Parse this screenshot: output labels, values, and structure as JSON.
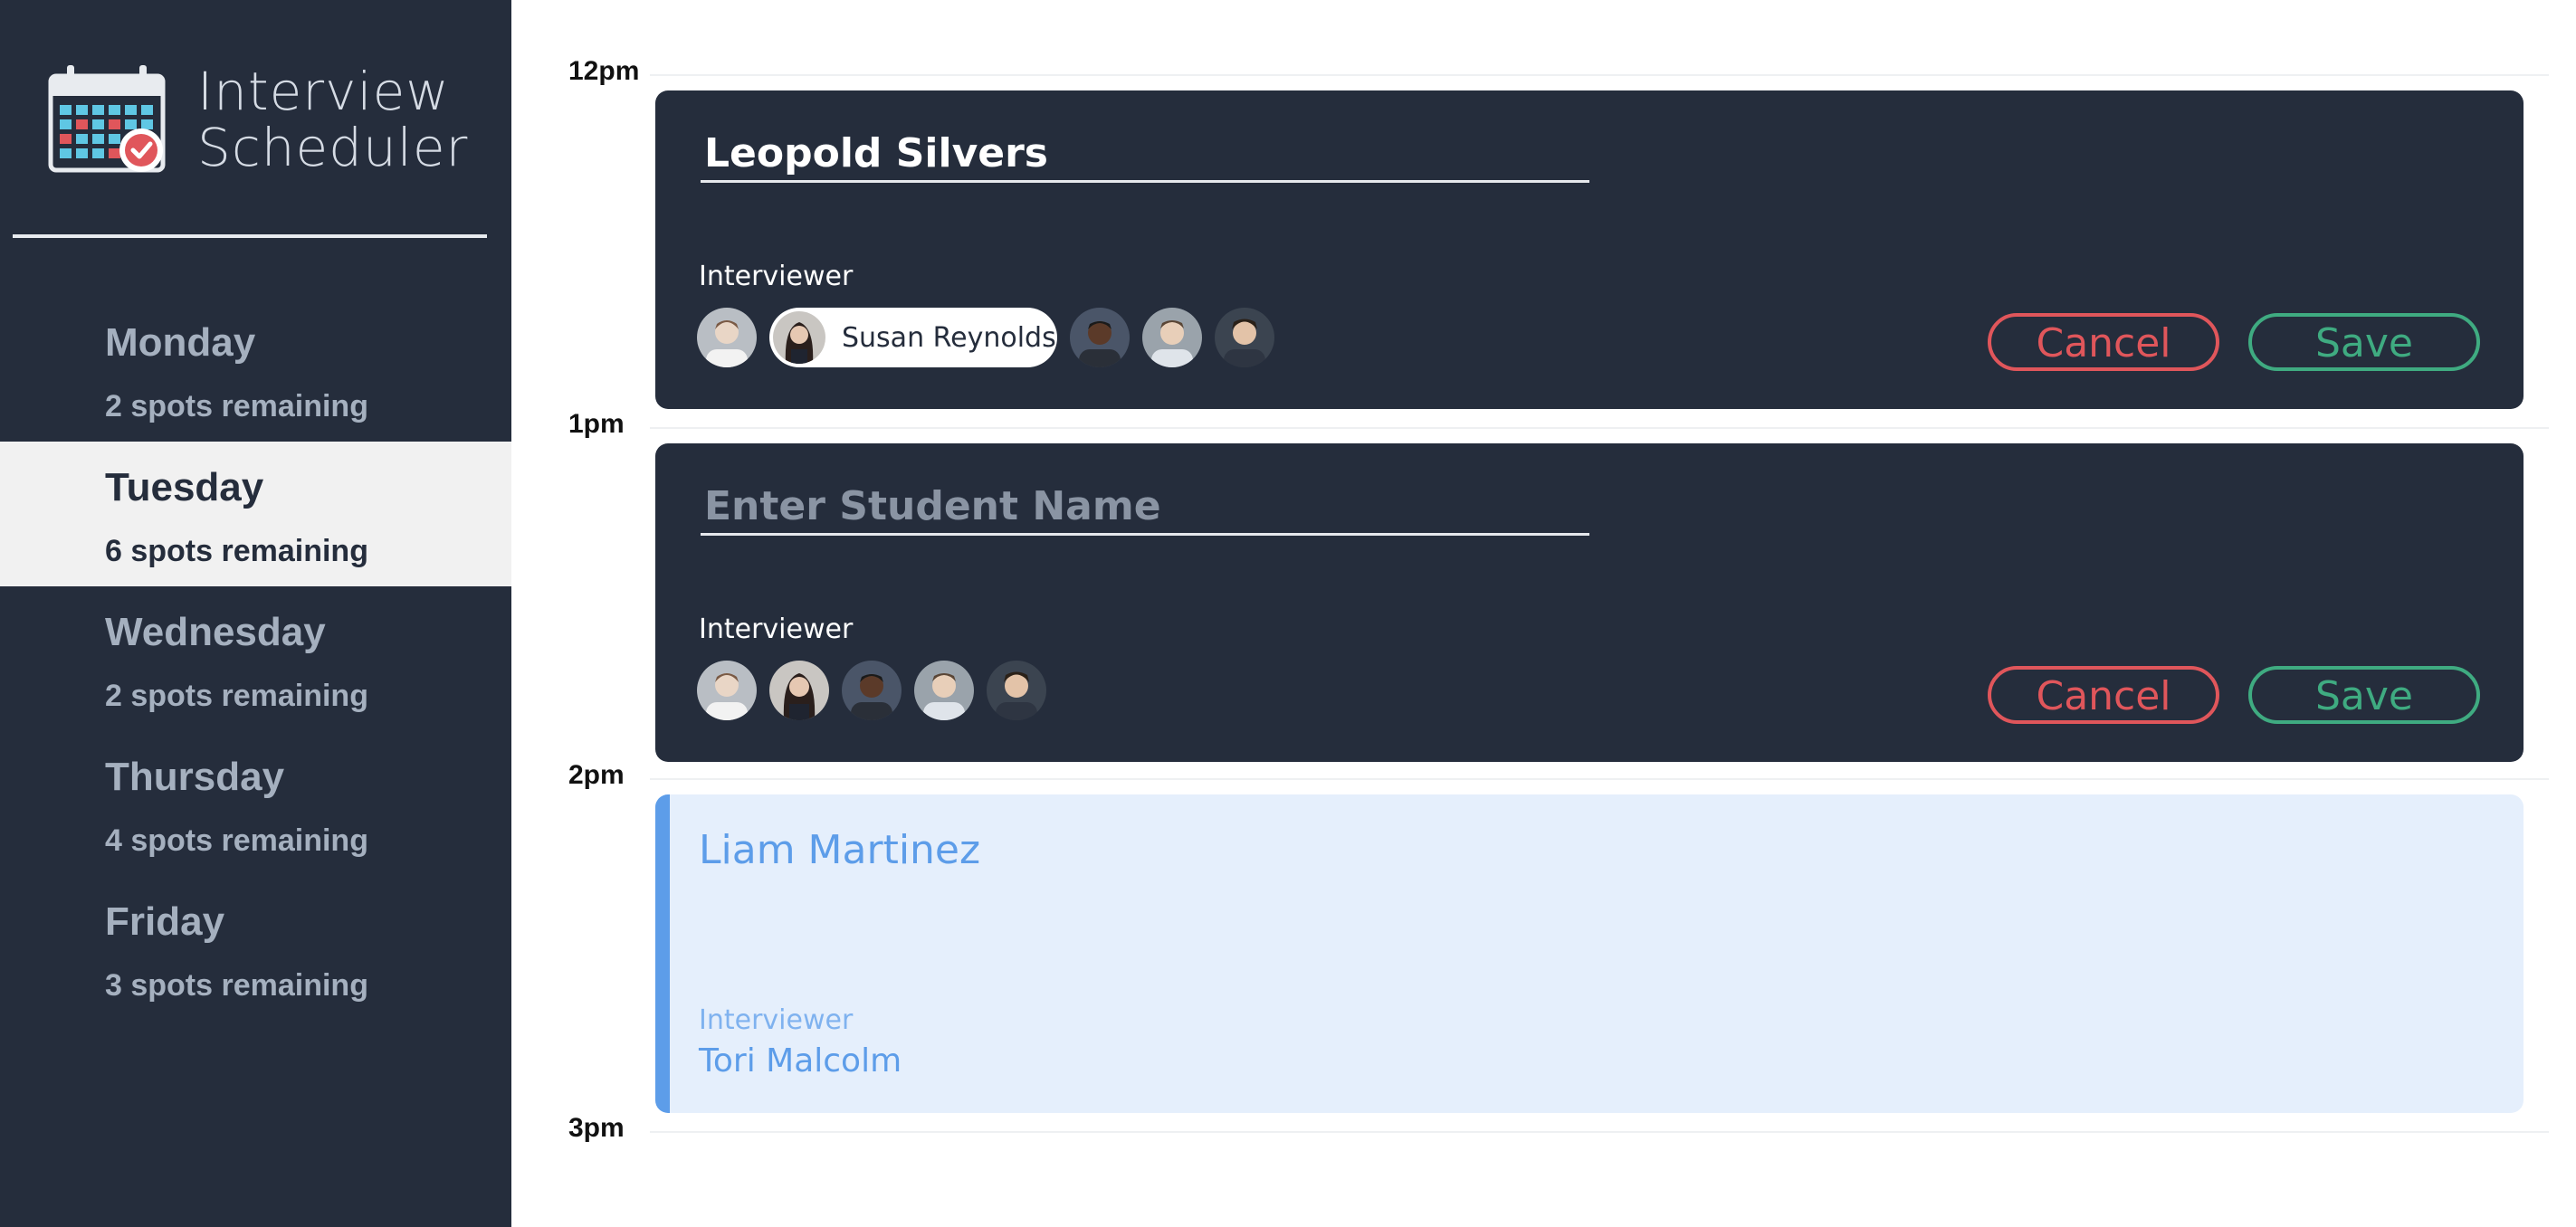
{
  "app": {
    "brand_line1": "Interview",
    "brand_line2": "Scheduler",
    "logo_icon": "calendar-check-icon"
  },
  "days": [
    {
      "name": "Monday",
      "spots": "2 spots remaining",
      "selected": false
    },
    {
      "name": "Tuesday",
      "spots": "6 spots remaining",
      "selected": true
    },
    {
      "name": "Wednesday",
      "spots": "2 spots remaining",
      "selected": false
    },
    {
      "name": "Thursday",
      "spots": "4 spots remaining",
      "selected": false
    },
    {
      "name": "Friday",
      "spots": "3 spots remaining",
      "selected": false
    }
  ],
  "times": [
    "12pm",
    "1pm",
    "2pm",
    "3pm"
  ],
  "appointments": [
    {
      "mode": "edit",
      "student_name": "Leopold Silvers",
      "interviewer_label": "Interviewer",
      "selected_interviewer": "Susan Reynolds",
      "cancel_label": "Cancel",
      "save_label": "Save"
    },
    {
      "mode": "create",
      "student_placeholder": "Enter Student Name",
      "interviewer_label": "Interviewer",
      "cancel_label": "Cancel",
      "save_label": "Save"
    },
    {
      "mode": "show",
      "student_name": "Liam Martinez",
      "interviewer_label": "Interviewer",
      "interviewer_name": "Tori Malcolm"
    }
  ],
  "colors": {
    "sidebar_bg": "#252d3c",
    "selected_day_bg": "#f1f1f1",
    "cancel": "#e0565b",
    "save": "#3fab81",
    "booked_bg": "#e5effc",
    "booked_accent": "#5d9de9"
  }
}
